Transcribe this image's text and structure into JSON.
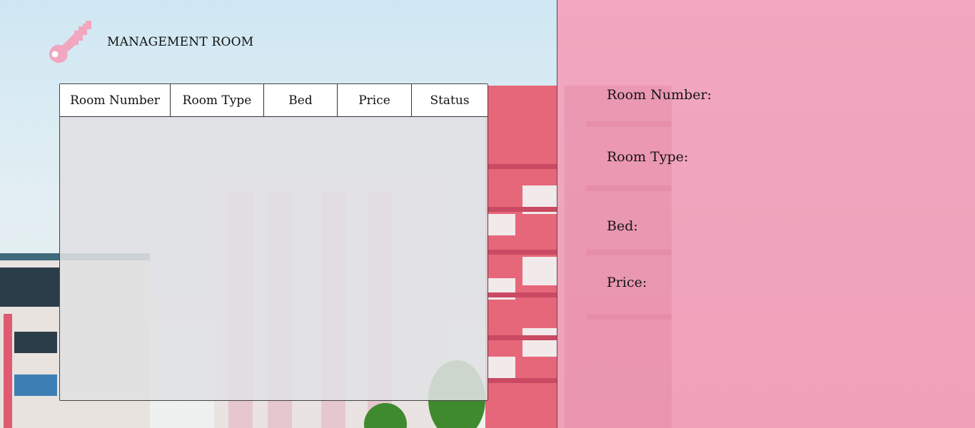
{
  "app": {
    "title": "MANAGEMENT ROOM",
    "icon": "key-icon",
    "accent_color": "#f2a6bf"
  },
  "table": {
    "columns": [
      "Room Number",
      "Room Type",
      "Bed",
      "Price",
      "Status"
    ],
    "rows": []
  },
  "form": {
    "room_number_label": "Room Number:",
    "room_type_label": "Room Type:",
    "bed_label": "Bed:",
    "price_label": "Price:"
  }
}
